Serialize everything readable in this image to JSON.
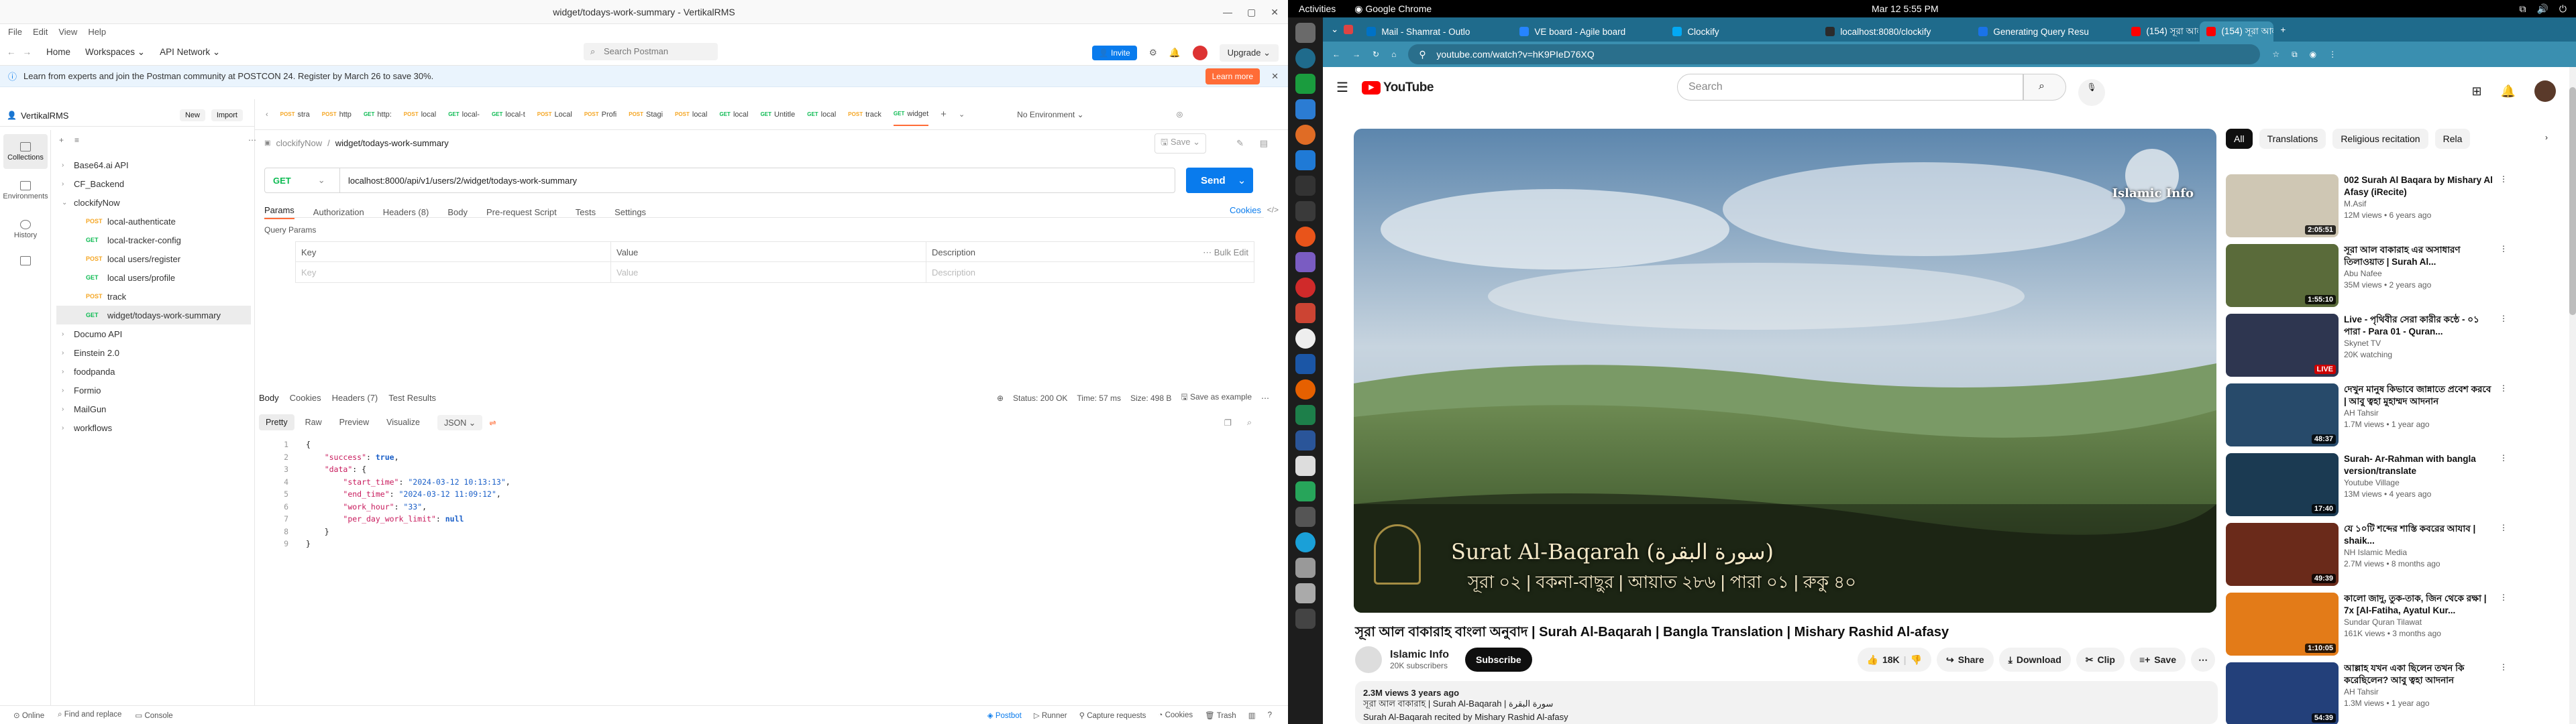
{
  "postman": {
    "window_title": "widget/todays-work-summary - VertikalRMS",
    "menu": [
      "File",
      "Edit",
      "View",
      "Help"
    ],
    "header": {
      "home": "Home",
      "workspaces": "Workspaces",
      "api_network": "API Network",
      "search": "Search Postman",
      "invite": "Invite",
      "upgrade": "Upgrade"
    },
    "banner": {
      "text": "Learn from experts and join the Postman community at POSTCON 24. Register by March 26 to save 30%.",
      "button": "Learn more"
    },
    "workspace": {
      "name": "VertikalRMS",
      "new": "New",
      "import": "Import"
    },
    "rail": [
      "Collections",
      "Environments",
      "History"
    ],
    "tree": [
      {
        "label": "Base64.ai API",
        "depth": 0,
        "method": ""
      },
      {
        "label": "CF_Backend",
        "depth": 0,
        "method": ""
      },
      {
        "label": "clockifyNow",
        "depth": 0,
        "method": "",
        "open": true
      },
      {
        "label": "local-authenticate",
        "depth": 1,
        "method": "POST"
      },
      {
        "label": "local-tracker-config",
        "depth": 1,
        "method": "GET"
      },
      {
        "label": "local users/register",
        "depth": 1,
        "method": "POST"
      },
      {
        "label": "local users/profile",
        "depth": 1,
        "method": "GET"
      },
      {
        "label": "track",
        "depth": 1,
        "method": "POST"
      },
      {
        "label": "widget/todays-work-summary",
        "depth": 1,
        "method": "GET",
        "selected": true
      },
      {
        "label": "Documo API",
        "depth": 0,
        "method": ""
      },
      {
        "label": "Einstein 2.0",
        "depth": 0,
        "method": ""
      },
      {
        "label": "foodpanda",
        "depth": 0,
        "method": ""
      },
      {
        "label": "Formio",
        "depth": 0,
        "method": ""
      },
      {
        "label": "MailGun",
        "depth": 0,
        "method": ""
      },
      {
        "label": "workflows",
        "depth": 0,
        "method": ""
      }
    ],
    "tabs": [
      {
        "method": "POST",
        "label": "stra"
      },
      {
        "method": "POST",
        "label": "http"
      },
      {
        "method": "GET",
        "label": "http:"
      },
      {
        "method": "POST",
        "label": "local"
      },
      {
        "method": "GET",
        "label": "local-"
      },
      {
        "method": "GET",
        "label": "local-t"
      },
      {
        "method": "POST",
        "label": "Local"
      },
      {
        "method": "POST",
        "label": "Profi"
      },
      {
        "method": "POST",
        "label": "Stagi"
      },
      {
        "method": "POST",
        "label": "local"
      },
      {
        "method": "GET",
        "label": "local"
      },
      {
        "method": "GET",
        "label": "Untitle"
      },
      {
        "method": "GET",
        "label": "local"
      },
      {
        "method": "POST",
        "label": "track"
      },
      {
        "method": "GET",
        "label": "widget"
      }
    ],
    "no_env": "No Environment",
    "breadcrumb": {
      "collection": "clockifyNow",
      "sep": "/",
      "request": "widget/todays-work-summary",
      "save": "Save"
    },
    "request": {
      "method": "GET",
      "url": "localhost:8000/api/v1/users/2/widget/todays-work-summary",
      "send": "Send"
    },
    "req_tabs": [
      "Params",
      "Authorization",
      "Headers (8)",
      "Body",
      "Pre-request Script",
      "Tests",
      "Settings"
    ],
    "cookies": "Cookies",
    "query_params": "Query Params",
    "grid": {
      "key": "Key",
      "value": "Value",
      "description": "Description",
      "bulk": "Bulk Edit"
    },
    "resp_tabs": [
      "Body",
      "Cookies",
      "Headers (7)",
      "Test Results"
    ],
    "resp_status": {
      "status": "Status: 200 OK",
      "time": "Time: 57 ms",
      "size": "Size: 498 B",
      "save": "Save as example"
    },
    "resp_views": [
      "Pretty",
      "Raw",
      "Preview",
      "Visualize"
    ],
    "resp_format": "JSON",
    "code_lines": [
      "{",
      "    \"success\": true,",
      "    \"data\": {",
      "        \"start_time\": \"2024-03-12 10:13:13\",",
      "        \"end_time\": \"2024-03-12 11:09:12\",",
      "        \"work_hour\": \"33\",",
      "        \"per_day_work_limit\": null",
      "    }",
      "}"
    ],
    "statusbar": [
      "Online",
      "Find and replace",
      "Console",
      "Postbot",
      "Runner",
      "Capture requests",
      "Cookies",
      "Trash"
    ]
  },
  "system": {
    "activities": "Activities",
    "app": "Google Chrome",
    "clock": "Mar 12  5:55 PM"
  },
  "chrome": {
    "tabs": [
      "Mail - Shamrat - Outlo",
      "VE board - Agile board",
      "Clockify",
      "localhost:8080/clockify",
      "Generating Query Resu",
      "(154) সূরা আল বাকারাহ",
      "(154) সূরা আল বাকারাহ"
    ],
    "address": "youtube.com/watch?v=hK9PIeD76XQ"
  },
  "youtube": {
    "search_placeholder": "Search",
    "chips": [
      "All",
      "Translations",
      "Religious recitation",
      "Rela"
    ],
    "video": {
      "title": "সূরা আল বাকারাহ বাংলা অনুবাদ | Surah Al-Baqarah | Bangla Translation | Mishary Rashid Al-afasy",
      "overlay_title": "Surat Al-Baqarah (سورة البقرة)",
      "overlay_sub": "সূরা ০২ | বকনা-বাছুর | আয়াত ২৮৬ | পারা ০১ | রুকু ৪০",
      "watermark": "Islamic Info",
      "channel": "Islamic Info",
      "subs": "20K subscribers",
      "subscribe": "Subscribe",
      "likes": "18K",
      "share": "Share",
      "download": "Download",
      "clip": "Clip",
      "save": "Save",
      "views": "2.3M views  3 years ago",
      "desc1": "সূরা আল বাকারাহ | Surah Al-Baqarah | سورة البقرة",
      "desc2": "Surah Al-Baqarah recited by Mishary Rashid Al-afasy"
    },
    "suggestions": [
      {
        "title": "002 Surah Al Baqara by Mishary Al Afasy (iRecite)",
        "channel": "M.Asif",
        "meta": "12M views • 6 years ago",
        "duration": "2:05:51",
        "color": "#cfc7b4"
      },
      {
        "title": "সূরা আল বাকারাহ এর অসাধারণ তিলাওয়াত | Surah Al...",
        "channel": "Abu Nafee",
        "meta": "35M views • 2 years ago",
        "duration": "1:55:10",
        "color": "#5a6b3a"
      },
      {
        "title": "Live - পৃথিবীর সেরা কারীর কন্ঠে - ০১ পারা - Para 01 - Quran...",
        "channel": "Skynet TV",
        "meta": "20K watching",
        "duration": "LIVE",
        "color": "#2e3650"
      },
      {
        "title": "দেখুন মানুষ কিভাবে জান্নাতে প্রবেশ করবে | আবু ত্বহা মুহাম্মদ আদনান",
        "channel": "AH Tahsir",
        "meta": "1.7M views • 1 year ago",
        "duration": "48:37",
        "color": "#274a6a"
      },
      {
        "title": "Surah- Ar-Rahman with bangla version/translate",
        "channel": "Youtube Village",
        "meta": "13M views • 4 years ago",
        "duration": "17:40",
        "color": "#1b3a52"
      },
      {
        "title": "যে ১০টি শব্দের শাস্তি কবরের আযাব | shaik...",
        "channel": "NH Islamic Media",
        "meta": "2.7M views • 8 months ago",
        "duration": "49:39",
        "color": "#6a2a1a"
      },
      {
        "title": "কালো জাদু, তুক-তাক, জিন থেকে রক্ষা | 7x [Al-Fatiha, Ayatul Kur...",
        "channel": "Sundar Quran Tilawat",
        "meta": "161K views • 3 months ago",
        "duration": "1:10:05",
        "color": "#e37b18"
      },
      {
        "title": "আল্লাহ যখন একা ছিলেন তখন কি করেছিলেন? আবু ত্বহা আদনান",
        "channel": "AH Tahsir",
        "meta": "1.3M views • 1 year ago",
        "duration": "54:39",
        "color": "#23407a"
      }
    ]
  },
  "colors": {
    "postman_orange": "#ff6c37",
    "postman_blue": "#097bed",
    "chrome_tab_bar": "#1f6b8c",
    "youtube_red": "#ff0000"
  }
}
